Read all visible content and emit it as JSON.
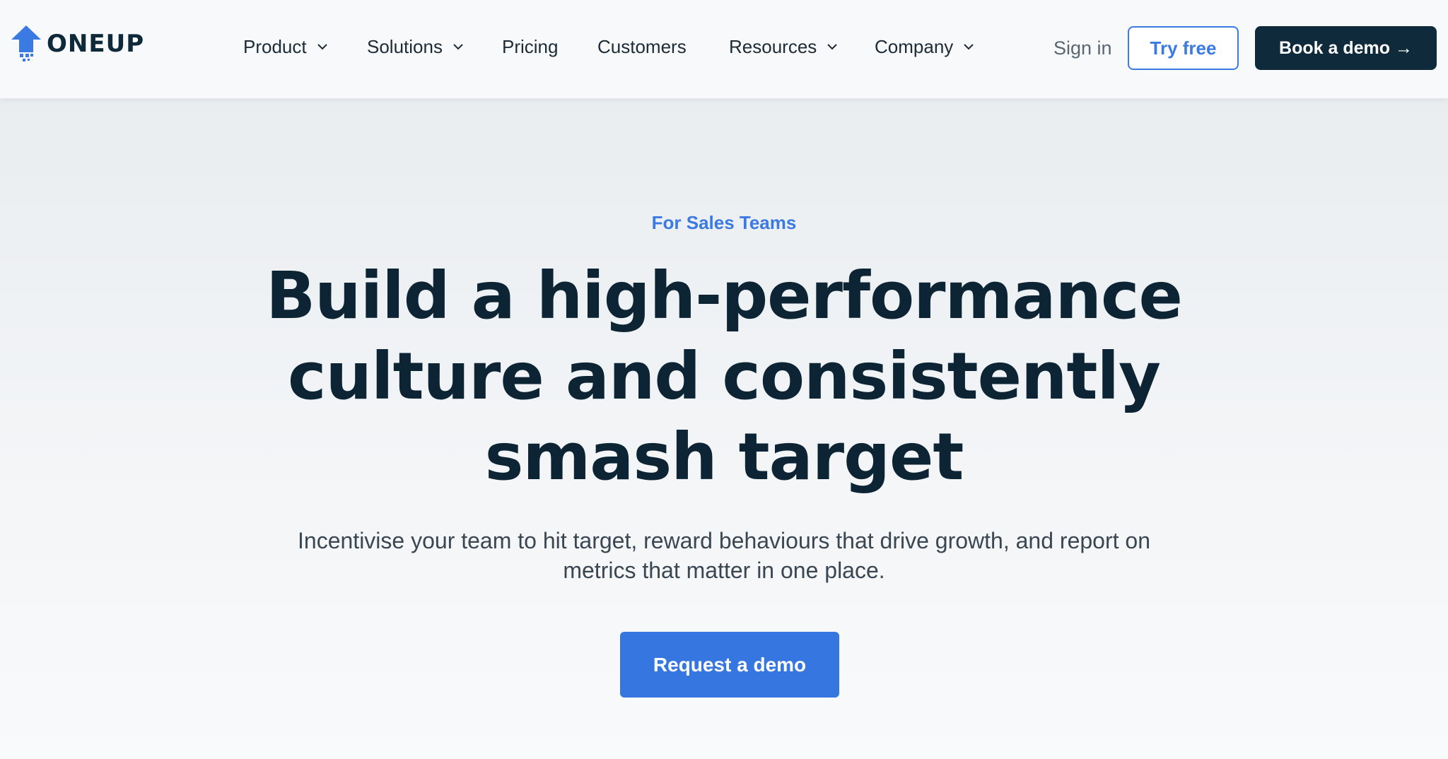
{
  "brand": {
    "name": "ONEUP",
    "accent_color": "#3b7ae3",
    "dark_color": "#0f2b3b"
  },
  "nav": {
    "items": [
      {
        "label": "Product",
        "has_dropdown": true
      },
      {
        "label": "Solutions",
        "has_dropdown": true
      },
      {
        "label": "Pricing",
        "has_dropdown": false
      },
      {
        "label": "Customers",
        "has_dropdown": false
      },
      {
        "label": "Resources",
        "has_dropdown": true
      },
      {
        "label": "Company",
        "has_dropdown": true
      }
    ],
    "sign_in": "Sign in",
    "try_free": "Try free",
    "book_demo": "Book a demo →"
  },
  "hero": {
    "eyebrow": "For Sales Teams",
    "headline_line1": "Build a high-performance",
    "headline_line2": "culture and consistently",
    "headline_line3": "smash target",
    "subtext_line1": "Incentivise your team to hit target, reward behaviours that drive growth, and report on",
    "subtext_line2": "metrics that matter in one place.",
    "cta": "Request a demo"
  },
  "icons": [
    "oneup-logo-icon",
    "chevron-down-icon"
  ]
}
